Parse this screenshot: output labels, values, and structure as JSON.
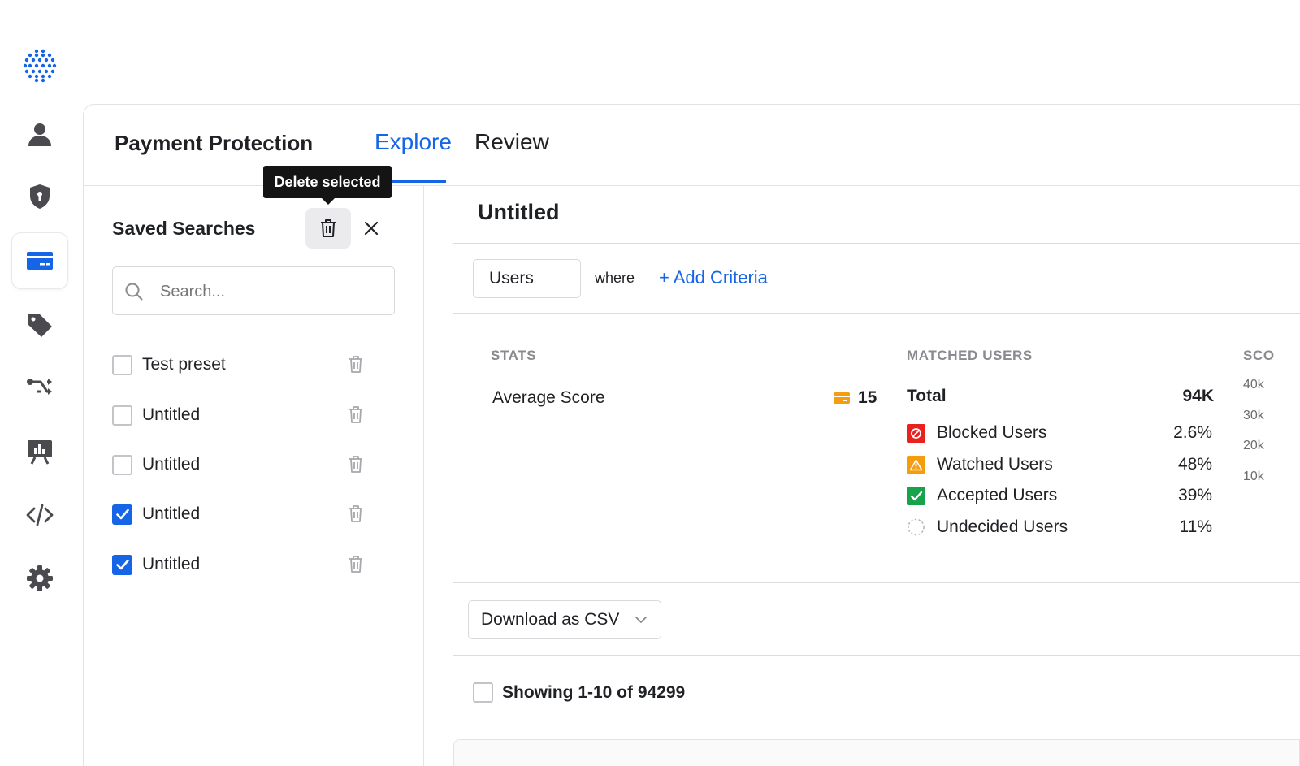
{
  "rail": {
    "items": [
      {
        "name": "user-icon"
      },
      {
        "name": "shield-icon"
      },
      {
        "name": "card-icon",
        "active": true
      },
      {
        "name": "tag-icon"
      },
      {
        "name": "routing-icon"
      },
      {
        "name": "presentation-icon"
      },
      {
        "name": "code-icon"
      },
      {
        "name": "gear-icon"
      }
    ],
    "accent": "#1565e6",
    "icon_color": "#4a4a4f"
  },
  "header": {
    "app_title": "Payment Protection",
    "tabs": [
      {
        "label": "Explore",
        "active": true
      },
      {
        "label": "Review",
        "active": false
      }
    ]
  },
  "tooltip": {
    "text": "Delete selected"
  },
  "saved_searches": {
    "title": "Saved Searches",
    "search": {
      "placeholder": "Search...",
      "value": ""
    },
    "items": [
      {
        "label": "Test preset",
        "checked": false
      },
      {
        "label": "Untitled",
        "checked": false
      },
      {
        "label": "Untitled",
        "checked": false
      },
      {
        "label": "Untitled",
        "checked": true
      },
      {
        "label": "Untitled",
        "checked": true
      }
    ]
  },
  "main": {
    "search_name": "Untitled",
    "entity": "Users",
    "where": "where",
    "add_criteria": "+ Add Criteria",
    "stats": {
      "label": "STATS",
      "average_score_label": "Average Score",
      "average_score_value": "15"
    },
    "matched": {
      "label": "MATCHED USERS",
      "total_label": "Total",
      "total_value": "94K",
      "rows": [
        {
          "label": "Blocked Users",
          "value": "2.6%",
          "color": "#e8221f",
          "icon": "block-icon"
        },
        {
          "label": "Watched Users",
          "value": "48%",
          "color": "#f59d0e",
          "icon": "warning-icon"
        },
        {
          "label": "Accepted Users",
          "value": "39%",
          "color": "#17a34a",
          "icon": "check-icon"
        },
        {
          "label": "Undecided Users",
          "value": "11%",
          "color": "#b5b5b9",
          "icon": "dashed-circle-icon"
        }
      ]
    },
    "score_section": {
      "label": "SCO",
      "y_ticks": [
        "40k",
        "30k",
        "20k",
        "10k"
      ]
    },
    "download_label": "Download as CSV",
    "showing": "Showing 1-10 of 94299"
  }
}
